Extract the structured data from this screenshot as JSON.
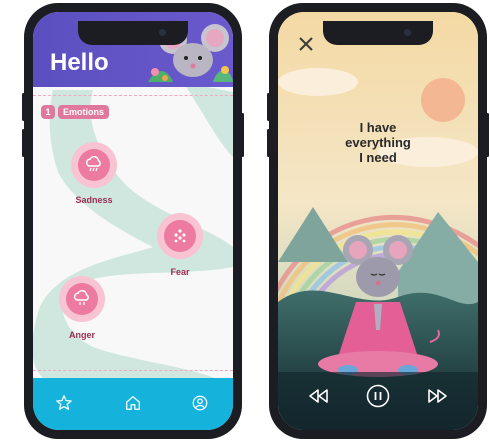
{
  "left_screen": {
    "header": {
      "title": "Hello"
    },
    "section": {
      "number": "1",
      "label": "Emotions"
    },
    "emotions": [
      {
        "label": "Sadness",
        "icon": "rain-cloud-icon"
      },
      {
        "label": "Fear",
        "icon": "dots-icon"
      },
      {
        "label": "Anger",
        "icon": "storm-cloud-icon"
      }
    ],
    "tabbar": {
      "items": [
        "star-icon",
        "home-icon",
        "profile-icon"
      ]
    },
    "colors": {
      "header": "#5b4fbf",
      "accent": "#e0789e",
      "tabbar": "#15b2dc",
      "path": "#cfe7de"
    }
  },
  "right_screen": {
    "affirmation": [
      "I have",
      "everything",
      "I need"
    ],
    "controls": [
      "close-icon",
      "rewind-icon",
      "pause-icon",
      "fast-forward-icon"
    ]
  }
}
